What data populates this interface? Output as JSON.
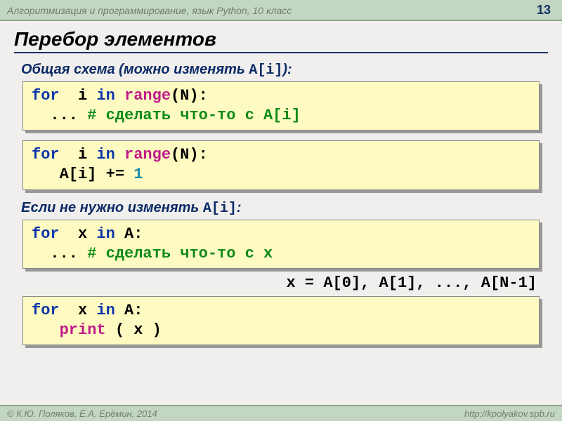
{
  "header": {
    "title": "Алгоритмизация и программирование, язык Python, 10 класс",
    "page": "13"
  },
  "slide_title": "Перебор элементов",
  "subhead1_a": "Общая схема (можно изменять ",
  "subhead1_b": "A[i]",
  "subhead1_c": "):",
  "code1": {
    "kw_for": "for",
    "var_i": "  i ",
    "kw_in": "in",
    "fn_range": " range",
    "paren_open": "(",
    "n": "N",
    "paren_close": "):",
    "line2a": "  ... ",
    "cmt": "# сделать что-то с A[i]"
  },
  "code2": {
    "kw_for": "for",
    "var_i": "  i ",
    "kw_in": "in",
    "fn_range": " range",
    "paren_open": "(",
    "n": "N",
    "paren_close": "):",
    "line2a": "   A[i] += ",
    "one": "1"
  },
  "subhead2_a": "Если не нужно изменять ",
  "subhead2_b": "A[i]",
  "subhead2_c": ":",
  "code3": {
    "kw_for": "for",
    "var_x": "  x ",
    "kw_in": "in",
    "arr": " A",
    "colon": ":",
    "line2a": "  ... ",
    "cmt": "# сделать что-то с x"
  },
  "assign_note": "x = A[0], A[1], ..., A[N-1]",
  "code4": {
    "kw_for": "for",
    "var_x": "  x ",
    "kw_in": "in",
    "arr": " A",
    "colon": ":",
    "indent": "   ",
    "fn_print": "print",
    "rest": " ( x )"
  },
  "footer": {
    "left": "© К.Ю. Поляков, Е.А. Ерёмин, 2014",
    "right": "http://kpolyakov.spb.ru"
  }
}
